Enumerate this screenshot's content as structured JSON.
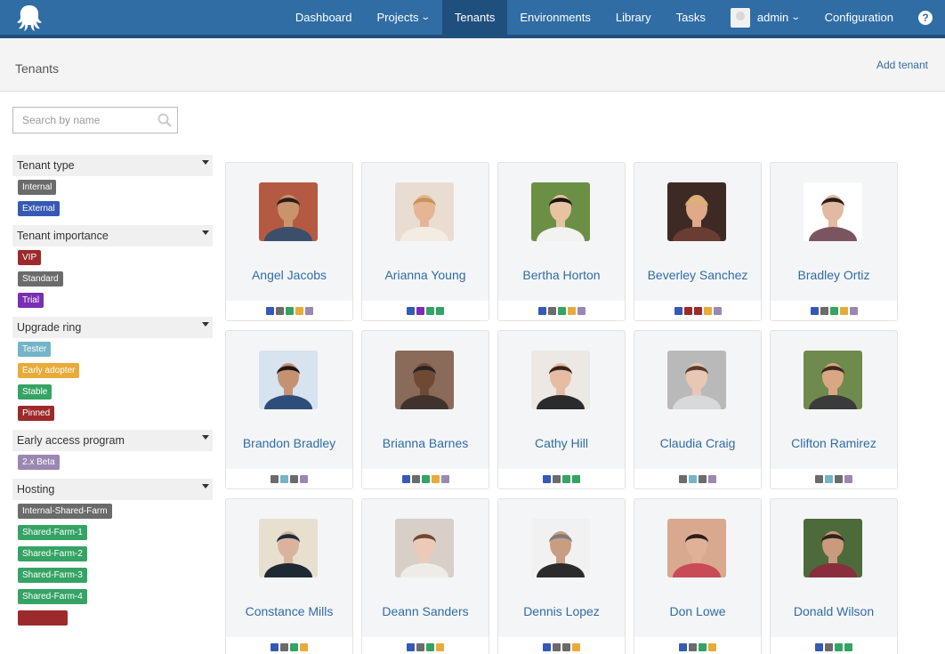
{
  "nav": {
    "items": [
      {
        "label": "Dashboard",
        "dropdown": false,
        "active": false
      },
      {
        "label": "Projects",
        "dropdown": true,
        "active": false
      },
      {
        "label": "Tenants",
        "dropdown": false,
        "active": true
      },
      {
        "label": "Environments",
        "dropdown": false,
        "active": false
      },
      {
        "label": "Library",
        "dropdown": false,
        "active": false
      },
      {
        "label": "Tasks",
        "dropdown": false,
        "active": false
      }
    ],
    "user_label": "admin",
    "configuration_label": "Configuration",
    "help_label": "?"
  },
  "header": {
    "title": "Tenants",
    "add_label": "Add tenant"
  },
  "search": {
    "placeholder": "Search by name"
  },
  "filter_groups": [
    {
      "title": "Tenant type",
      "tags": [
        {
          "label": "Internal",
          "color": "#6b6b6b"
        },
        {
          "label": "External",
          "color": "#3559b5"
        }
      ]
    },
    {
      "title": "Tenant importance",
      "tags": [
        {
          "label": "VIP",
          "color": "#9c2a2a"
        },
        {
          "label": "Standard",
          "color": "#6b6b6b"
        },
        {
          "label": "Trial",
          "color": "#7b2fb0"
        }
      ]
    },
    {
      "title": "Upgrade ring",
      "tags": [
        {
          "label": "Tester",
          "color": "#74b4c9"
        },
        {
          "label": "Early adopter",
          "color": "#e8ab3a"
        },
        {
          "label": "Stable",
          "color": "#35a364"
        },
        {
          "label": "Pinned",
          "color": "#9c2a2a"
        }
      ]
    },
    {
      "title": "Early access program",
      "tags": [
        {
          "label": "2.x Beta",
          "color": "#9a88b2"
        }
      ]
    },
    {
      "title": "Hosting",
      "tags": [
        {
          "label": "Internal-Shared-Farm",
          "color": "#6b6b6b"
        },
        {
          "label": "Shared-Farm-1",
          "color": "#35a364"
        },
        {
          "label": "Shared-Farm-2",
          "color": "#35a364"
        },
        {
          "label": "Shared-Farm-3",
          "color": "#35a364"
        },
        {
          "label": "Shared-Farm-4",
          "color": "#35a364"
        },
        {
          "label": "",
          "color": "#9c2a2a"
        }
      ]
    }
  ],
  "tenants": [
    {
      "name": "Angel Jacobs",
      "photo_bg": "#b55a42",
      "skin": "#c9936e",
      "hair": "#2a1d14",
      "shirt": "#3b4f6b",
      "tags": [
        "#3559b5",
        "#6b6b6b",
        "#35a364",
        "#e8ab3a",
        "#9a88b2"
      ]
    },
    {
      "name": "Arianna Young",
      "photo_bg": "#e9ddd2",
      "skin": "#e5b596",
      "hair": "#c79457",
      "shirt": "#f3ece3",
      "tags": [
        "#3559b5",
        "#7b2fb0",
        "#35a364",
        "#35a364"
      ]
    },
    {
      "name": "Bertha Horton",
      "photo_bg": "#6c8f46",
      "skin": "#e8c3a2",
      "hair": "#1b1410",
      "shirt": "#f2f2f0",
      "tags": [
        "#3559b5",
        "#6b6b6b",
        "#35a364",
        "#e8ab3a",
        "#9a88b2"
      ]
    },
    {
      "name": "Beverley Sanchez",
      "photo_bg": "#3e2a24",
      "skin": "#e0a98a",
      "hair": "#d9b46a",
      "shirt": "#6a3d33",
      "tags": [
        "#3559b5",
        "#9c2a2a",
        "#9c2a2a",
        "#e8ab3a",
        "#9a88b2"
      ]
    },
    {
      "name": "Bradley Ortiz",
      "photo_bg": "#ffffff",
      "skin": "#e2b9a1",
      "hair": "#2b1d18",
      "shirt": "#7a5560",
      "tags": [
        "#3559b5",
        "#6b6b6b",
        "#35a364",
        "#e8ab3a",
        "#9a88b2"
      ]
    },
    {
      "name": "Brandon Bradley",
      "photo_bg": "#d7e3ee",
      "skin": "#c49272",
      "hair": "#1e1714",
      "shirt": "#2e4d7b",
      "tags": [
        "#6b6b6b",
        "#74b4c9",
        "#6b6b6b",
        "#9a88b2"
      ]
    },
    {
      "name": "Brianna Barnes",
      "photo_bg": "#8a6a58",
      "skin": "#6e4a34",
      "hair": "#2a2220",
      "shirt": "#40332e",
      "tags": [
        "#3559b5",
        "#6b6b6b",
        "#35a364",
        "#e8ab3a",
        "#9a88b2"
      ]
    },
    {
      "name": "Cathy Hill",
      "photo_bg": "#ece8e4",
      "skin": "#e6bda3",
      "hair": "#3a2418",
      "shirt": "#2b2b2b",
      "tags": [
        "#3559b5",
        "#6b6b6b",
        "#35a364",
        "#35a364"
      ]
    },
    {
      "name": "Claudia Craig",
      "photo_bg": "#b9b9b9",
      "skin": "#e8c7b4",
      "hair": "#5a3b2c",
      "shirt": "#d9d9d9",
      "tags": [
        "#6b6b6b",
        "#74b4c9",
        "#6b6b6b",
        "#9a88b2"
      ]
    },
    {
      "name": "Clifton Ramirez",
      "photo_bg": "#6f8a4d",
      "skin": "#d9a784",
      "hair": "#3a2a1e",
      "shirt": "#3b3b3b",
      "tags": [
        "#6b6b6b",
        "#74b4c9",
        "#6b6b6b",
        "#9a88b2"
      ]
    },
    {
      "name": "Constance Mills",
      "photo_bg": "#e7e0cf",
      "skin": "#dbb39c",
      "hair": "#1a2d3c",
      "shirt": "#1e2a33",
      "tags": [
        "#3559b5",
        "#6b6b6b",
        "#35a364",
        "#e8ab3a"
      ]
    },
    {
      "name": "Deann Sanders",
      "photo_bg": "#d7cfc8",
      "skin": "#eccab7",
      "hair": "#6b4a35",
      "shirt": "#efece8",
      "tags": [
        "#3559b5",
        "#6b6b6b",
        "#35a364",
        "#e8ab3a"
      ]
    },
    {
      "name": "Dennis Lopez",
      "photo_bg": "#f1f1f1",
      "skin": "#c99d82",
      "hair": "#7b7b7b",
      "shirt": "#2b2b2b",
      "tags": [
        "#3559b5",
        "#6b6b6b",
        "#6b6b6b",
        "#e8ab3a"
      ]
    },
    {
      "name": "Don Lowe",
      "photo_bg": "#d8a98e",
      "skin": "#e0b097",
      "hair": "#2a1f1a",
      "shirt": "#c94b55",
      "tags": [
        "#3559b5",
        "#6b6b6b",
        "#35a364",
        "#e8ab3a"
      ]
    },
    {
      "name": "Donald Wilson",
      "photo_bg": "#4d6a3a",
      "skin": "#c99a7c",
      "hair": "#2d231d",
      "shirt": "#8a2e3e",
      "tags": [
        "#3559b5",
        "#6b6b6b",
        "#35a364",
        "#35a364"
      ]
    }
  ]
}
